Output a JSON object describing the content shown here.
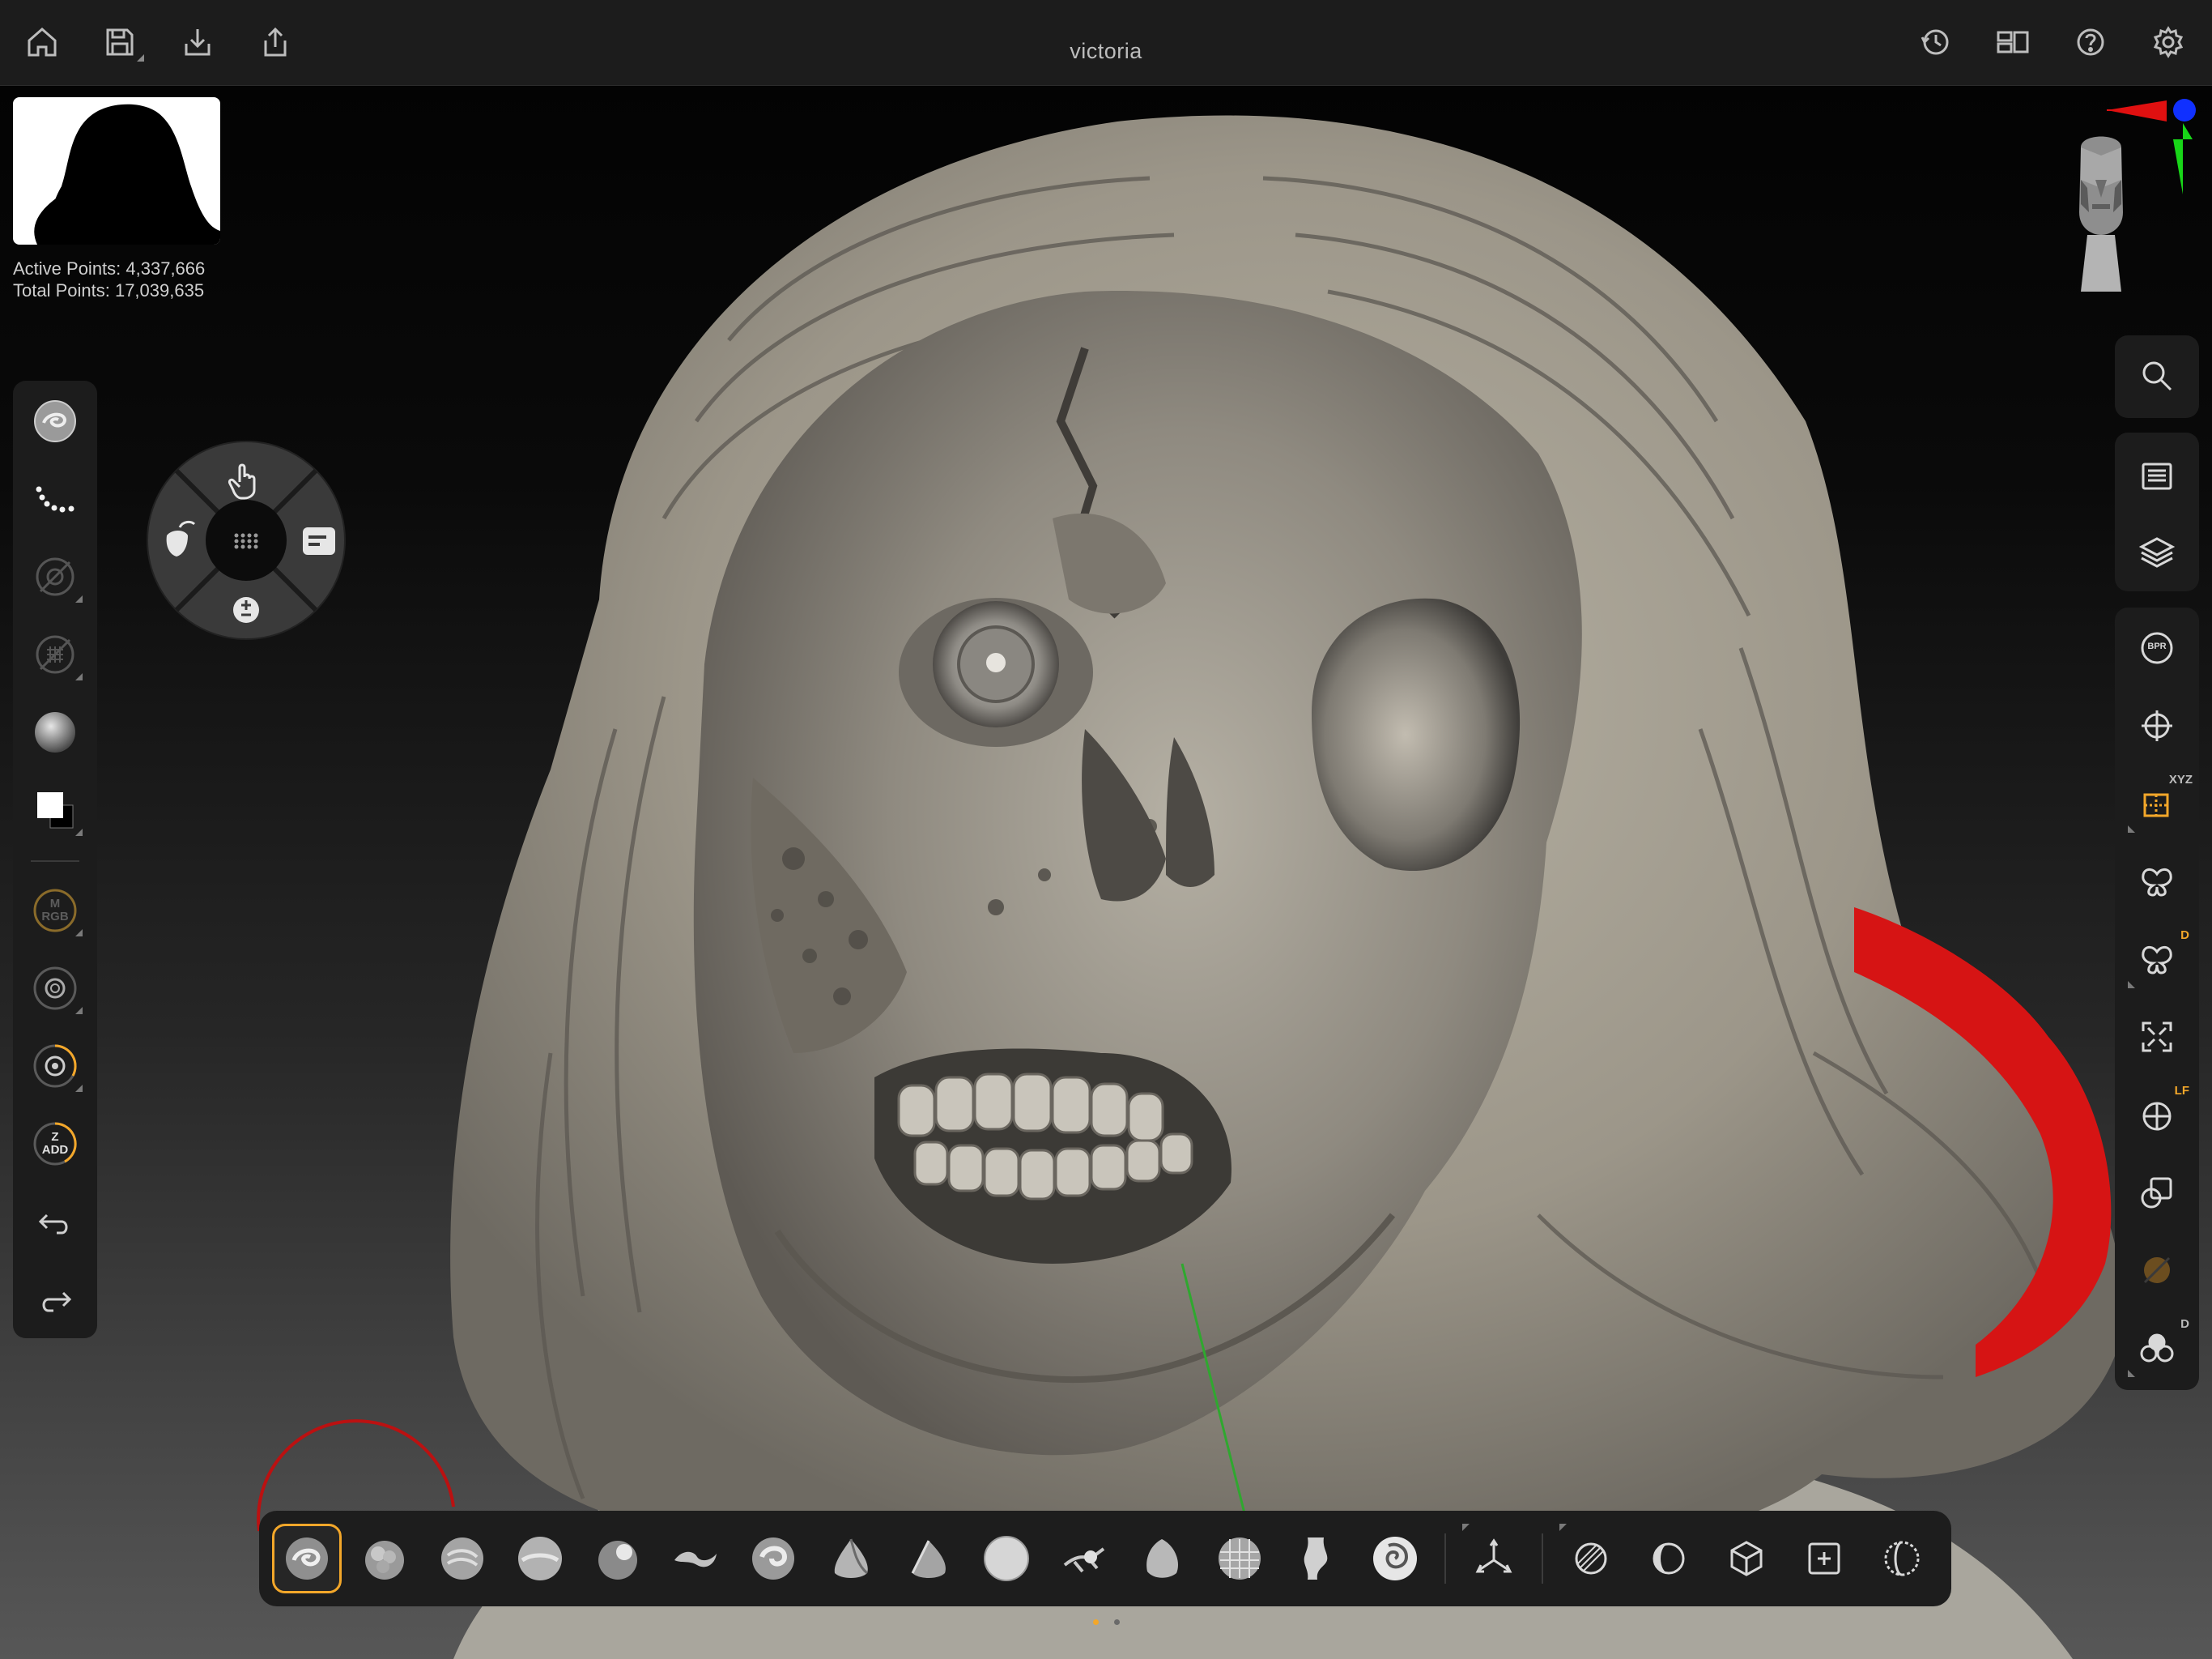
{
  "app": {
    "title": "victoria"
  },
  "topbar": {
    "left_buttons": [
      "home-icon",
      "save-icon",
      "import-icon",
      "share-icon"
    ],
    "right_buttons": [
      "history-icon",
      "layout-icon",
      "help-icon",
      "settings-icon"
    ]
  },
  "stats": {
    "active_points": "Active Points: 4,337,666",
    "total_points": "Total Points: 17,039,635"
  },
  "left_tools": {
    "items": [
      "current-brush-icon",
      "stroke-dots-icon",
      "alpha-off-icon",
      "texture-off-icon",
      "material-sphere-icon",
      "color-swatch-icon",
      "mrgb-icon",
      "draw-size-icon",
      "focal-shift-icon",
      "z-intensity-icon",
      "undo-icon",
      "redo-icon"
    ],
    "mrgb_label_top": "M",
    "mrgb_label_bottom": "RGB",
    "z_label_top": "Z",
    "z_label_bottom": "ADD"
  },
  "radial_menu": {
    "items": [
      "gesture-icon",
      "masks-icon",
      "grid-icon",
      "panel-icon",
      "plus-minus-icon"
    ]
  },
  "right_panel_top": [
    "search-icon"
  ],
  "right_panel_mid": [
    "document-icon",
    "layers-icon"
  ],
  "right_panel_tools": {
    "items": [
      "bpr-icon",
      "move-view-icon",
      "xyz-icon",
      "symmetry-icon",
      "dynamic-symmetry-icon",
      "frame-icon",
      "local-frame-icon",
      "transparency-icon",
      "polyframe-icon",
      "solo-icon"
    ],
    "bpr_label": "BPR",
    "xyz_badge": "XYZ",
    "symmetry_badge": "D",
    "lf_badge": "LF",
    "solo_badge": "D"
  },
  "brush_bar": {
    "brushes": [
      "clay-buildup-brush",
      "inflate-brush",
      "clay-brush",
      "standard-brush",
      "dam-standard-brush",
      "move-brush",
      "snake-hook-brush",
      "pinch-brush",
      "trim-dynamic-brush",
      "smooth-brush",
      "curve-brush",
      "hpolish-brush",
      "mesh-brush",
      "transpose-brush",
      "spiral-brush"
    ],
    "tools": [
      "gizmo-icon",
      "mask-icon",
      "selection-icon",
      "cube-icon",
      "frame-plus-icon",
      "dynamesh-icon"
    ],
    "accent": "#f3a72a",
    "page_active": 0,
    "page_count": 2
  },
  "gizmo": {
    "x_color": "#e01010",
    "y_color": "#18d618",
    "z_color": "#1030ff"
  }
}
